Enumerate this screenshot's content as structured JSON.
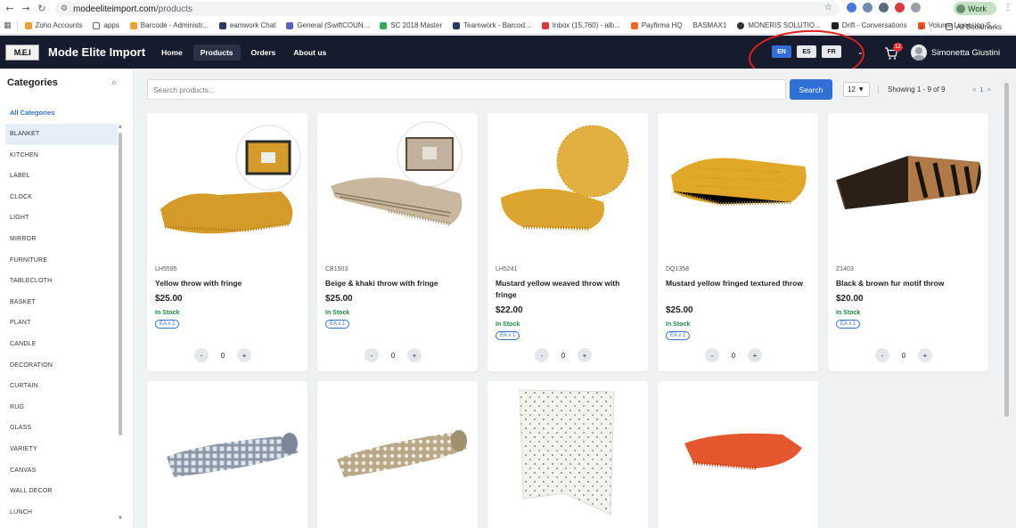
{
  "browser": {
    "url_host": "modeeliteimport.com",
    "url_path": "/products",
    "profile_label": "Work",
    "bookmarks": [
      "Zoho Accounts",
      "apps",
      "Barcode - Administr...",
      "eamwork Chat",
      "General (SwiftCOUN...",
      "SC 2018 Master",
      "Teamwork - Barcod...",
      "Inbox (15,760) - alb...",
      "Payfirma HQ",
      "BASMAX1",
      "MONERIS SOLUTIO...",
      "Drift - Conversations",
      "Volume Licensing S..."
    ],
    "bookmarks_more": "»",
    "all_bookmarks": "All Bookmarks"
  },
  "navbar": {
    "logo_text": "M.E.I",
    "brand": "Mode Elite Import",
    "links": [
      "Home",
      "Products",
      "Orders",
      "About us"
    ],
    "active_link": "Products",
    "languages": [
      "EN",
      "ES",
      "FR"
    ],
    "active_language": "EN",
    "cart_count": "12",
    "user_name": "Simonetta Giustini",
    "accent_color": "#2f6fd6",
    "annotation_color": "#e0201c"
  },
  "sidebar": {
    "title": "Categories",
    "all_label": "All Categories",
    "active_category": "BLANKET",
    "items": [
      "BLANKET",
      "KITCHEN",
      "LABEL",
      "CLOCK",
      "LIGHT",
      "MIRROR",
      "FURNITURE",
      "TABLECLOTH",
      "BASKET",
      "PLANT",
      "CANDLE",
      "DECORATION",
      "CURTAIN",
      "RUG",
      "GLASS",
      "VARIETY",
      "CANVAS",
      "WALL DECOR",
      "LUNCH"
    ]
  },
  "toolbar": {
    "search_placeholder": "Search products...",
    "search_button": "Search",
    "per_page": "12",
    "showing": "Showing 1 - 9 of 9",
    "pager_prev": "<",
    "current_page": "1",
    "pager_next": ">"
  },
  "products": [
    {
      "code": "LH5595",
      "name": "Yellow throw with fringe",
      "price": "$25.00",
      "stock": "In Stock",
      "unit": "EA x 1",
      "qty": "0",
      "color": "#d49a2a"
    },
    {
      "code": "CB1503",
      "name": "Beige & khaki throw with fringe",
      "price": "$25.00",
      "stock": "In Stock",
      "unit": "EA x 1",
      "qty": "0",
      "color": "#c8b8a0"
    },
    {
      "code": "LH5241",
      "name": "Mustard yellow weaved throw with fringe",
      "price": "$22.00",
      "stock": "In Stock",
      "unit": "EA x 1",
      "qty": "0",
      "color": "#dca530"
    },
    {
      "code": "DQ1358",
      "name": "Mustard yellow fringed textured throw",
      "price": "$25.00",
      "stock": "In Stock",
      "unit": "EA x 1",
      "qty": "0",
      "color": "#e0a826"
    },
    {
      "code": "Z1403",
      "name": "Black & brown fur motif throw",
      "price": "$20.00",
      "stock": "In Stock",
      "unit": "EA x 1",
      "qty": "0",
      "color": "#6b4a30"
    },
    {
      "color": "#8a96a8"
    },
    {
      "color": "#b8a888"
    },
    {
      "color": "#f4f2ec"
    },
    {
      "color": "#e4572e"
    }
  ]
}
